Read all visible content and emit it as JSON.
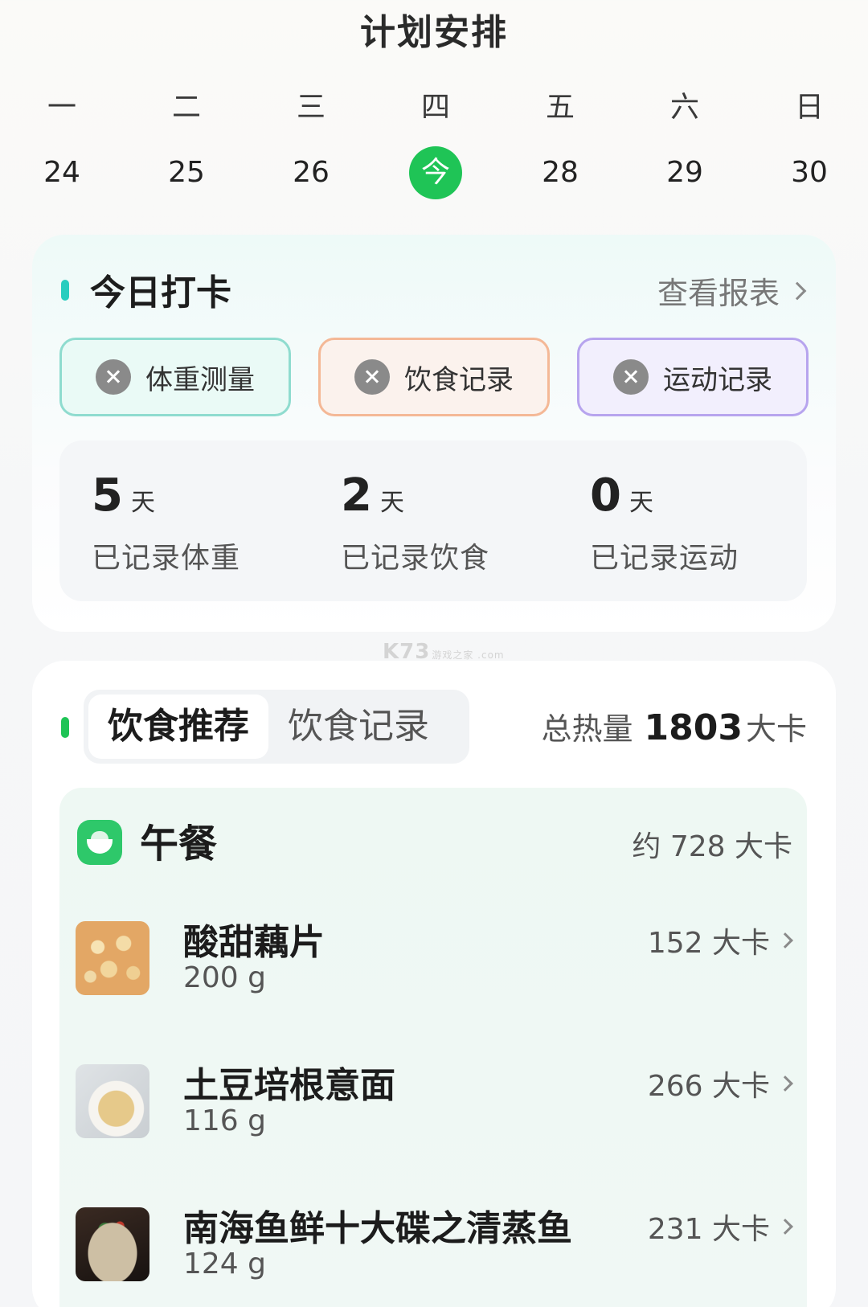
{
  "header": {
    "title": "计划安排"
  },
  "week": {
    "days": [
      {
        "weekday": "一",
        "date": "24"
      },
      {
        "weekday": "二",
        "date": "25"
      },
      {
        "weekday": "三",
        "date": "26"
      },
      {
        "weekday": "四",
        "date": "今",
        "is_today": true
      },
      {
        "weekday": "五",
        "date": "28"
      },
      {
        "weekday": "六",
        "date": "29"
      },
      {
        "weekday": "日",
        "date": "30"
      }
    ]
  },
  "checkin": {
    "title": "今日打卡",
    "report_link": "查看报表",
    "buttons": [
      {
        "label": "体重测量"
      },
      {
        "label": "饮食记录"
      },
      {
        "label": "运动记录"
      }
    ],
    "stats": [
      {
        "value": "5",
        "unit": "天",
        "label": "已记录体重"
      },
      {
        "value": "2",
        "unit": "天",
        "label": "已记录饮食"
      },
      {
        "value": "0",
        "unit": "天",
        "label": "已记录运动"
      }
    ]
  },
  "watermark": {
    "main": "K73",
    "sub": "游戏之家 .com"
  },
  "diet": {
    "tabs": [
      {
        "label": "饮食推荐",
        "active": true
      },
      {
        "label": "饮食记录",
        "active": false
      }
    ],
    "total_label": "总热量",
    "total_value": "1803",
    "total_unit": "大卡",
    "meal": {
      "title": "午餐",
      "kcal": "约 728 大卡",
      "foods": [
        {
          "name": "酸甜藕片",
          "weight": "200 g",
          "kcal": "152 大卡",
          "image": "lotus-root-slices"
        },
        {
          "name": "土豆培根意面",
          "weight": "116 g",
          "kcal": "266 大卡",
          "image": "potato-bacon-pasta"
        },
        {
          "name": "南海鱼鲜十大碟之清蒸鱼",
          "weight": "124 g",
          "kcal": "231 大卡",
          "image": "steamed-fish"
        }
      ]
    }
  },
  "colors": {
    "accent_green": "#1fc456",
    "teal": "#28cdbf",
    "weight_border": "#8fdccf",
    "diet_border": "#f4b896",
    "exercise_border": "#b7a4ee"
  }
}
